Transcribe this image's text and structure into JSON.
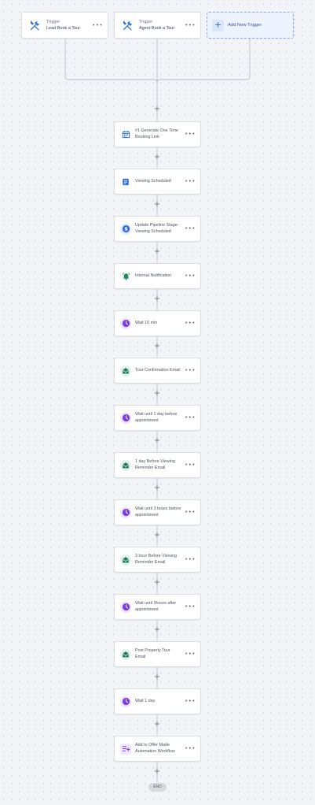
{
  "triggers": [
    {
      "kind": "Trigger",
      "name": "Lead Book a Tour",
      "icon": "wrench-screwdriver-icon"
    },
    {
      "kind": "Trigger",
      "name": "Agent Book a Tour",
      "icon": "wrench-screwdriver-icon"
    }
  ],
  "add_trigger": {
    "label": "Add New Trigger",
    "icon": "+"
  },
  "more_glyph": "•••",
  "plus_glyph": "+",
  "steps": [
    {
      "label": "#1 Generate One Time Booking Link",
      "icon": "calendar-icon",
      "color": "#2f6fdd",
      "bg": "#ffffff"
    },
    {
      "label": "Viewing Scheduled",
      "icon": "form-icon",
      "color": "#2f6fdd",
      "bg": "#ffffff"
    },
    {
      "label": "Update Pipeline Stage- Viewing Scheduled",
      "icon": "dollar-icon",
      "color": "#2f6fdd",
      "bg": "#e3ecfd"
    },
    {
      "label": "Internal Notification",
      "icon": "bell-icon",
      "color": "#1f8a5b",
      "bg": "#ffffff"
    },
    {
      "label": "Wait 10 min",
      "icon": "clock-icon",
      "color": "#7c3aed",
      "bg": "#ece4fd"
    },
    {
      "label": "Tour Confirmation Email",
      "icon": "email-icon",
      "color": "#1f7a55",
      "bg": "#e0f2ea"
    },
    {
      "label": "Wait until 1 day before appointment",
      "icon": "clock-icon",
      "color": "#7c3aed",
      "bg": "#ece4fd"
    },
    {
      "label": "1 day Before Viewing Reminder Email",
      "icon": "email-icon",
      "color": "#1f7a55",
      "bg": "#e0f2ea"
    },
    {
      "label": "Wait until 3 hours before appointment",
      "icon": "clock-icon",
      "color": "#7c3aed",
      "bg": "#ece4fd"
    },
    {
      "label": "3 hour Before Viewing Reminder Email",
      "icon": "email-icon",
      "color": "#1f7a55",
      "bg": "#e0f2ea"
    },
    {
      "label": "Wait until 3hours after appointment",
      "icon": "clock-icon",
      "color": "#7c3aed",
      "bg": "#ece4fd"
    },
    {
      "label": "Post Property Tour Email",
      "icon": "email-icon",
      "color": "#1f7a55",
      "bg": "#e0f2ea"
    },
    {
      "label": "Wait 1 day",
      "icon": "clock-icon",
      "color": "#7c3aed",
      "bg": "#ece4fd"
    },
    {
      "label": "Add to Offer Made Automation Workflow",
      "icon": "workflow-add-icon",
      "color": "#7c3aed",
      "bg": "#efe8fd"
    }
  ],
  "end_label": "END",
  "colors": {
    "line": "#b9bfca",
    "accent": "#3b5bdb"
  }
}
